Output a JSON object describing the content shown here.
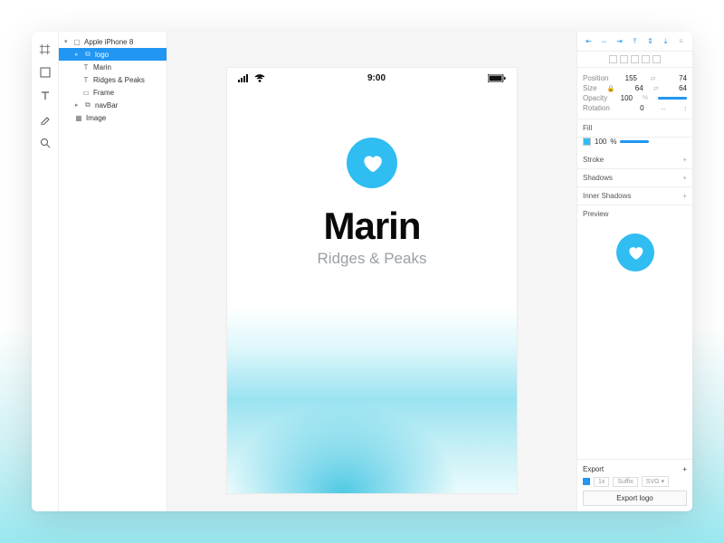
{
  "layers": {
    "root": "Apple iPhone 8",
    "items": [
      {
        "label": "logo",
        "selected": true,
        "indent": 1,
        "icon": "group"
      },
      {
        "label": "Marin",
        "indent": 2,
        "icon": "text"
      },
      {
        "label": "Ridges & Peaks",
        "indent": 2,
        "icon": "text"
      },
      {
        "label": "Frame",
        "indent": 2,
        "icon": "frame"
      },
      {
        "label": "navBar",
        "indent": 1,
        "icon": "group"
      },
      {
        "label": "Image",
        "indent": 1,
        "icon": "image"
      }
    ]
  },
  "canvas": {
    "status_time": "9:00",
    "brand_title": "Marin",
    "brand_subtitle": "Ridges & Peaks"
  },
  "inspector": {
    "position": {
      "label": "Position",
      "x": "155",
      "y": "74"
    },
    "size": {
      "label": "Size",
      "w": "64",
      "h": "64"
    },
    "opacity": {
      "label": "Opacity",
      "value": "100",
      "unit": "%"
    },
    "rotation": {
      "label": "Rotation",
      "value": "0"
    },
    "fill": {
      "label": "Fill",
      "opacity": "100",
      "unit": "%"
    },
    "stroke_label": "Stroke",
    "shadows_label": "Shadows",
    "inner_shadows_label": "Inner Shadows",
    "preview_label": "Preview",
    "export": {
      "label": "Export",
      "scale": "1x",
      "suffix_placeholder": "Suffix",
      "format": "SVG",
      "button": "Export logo"
    }
  }
}
